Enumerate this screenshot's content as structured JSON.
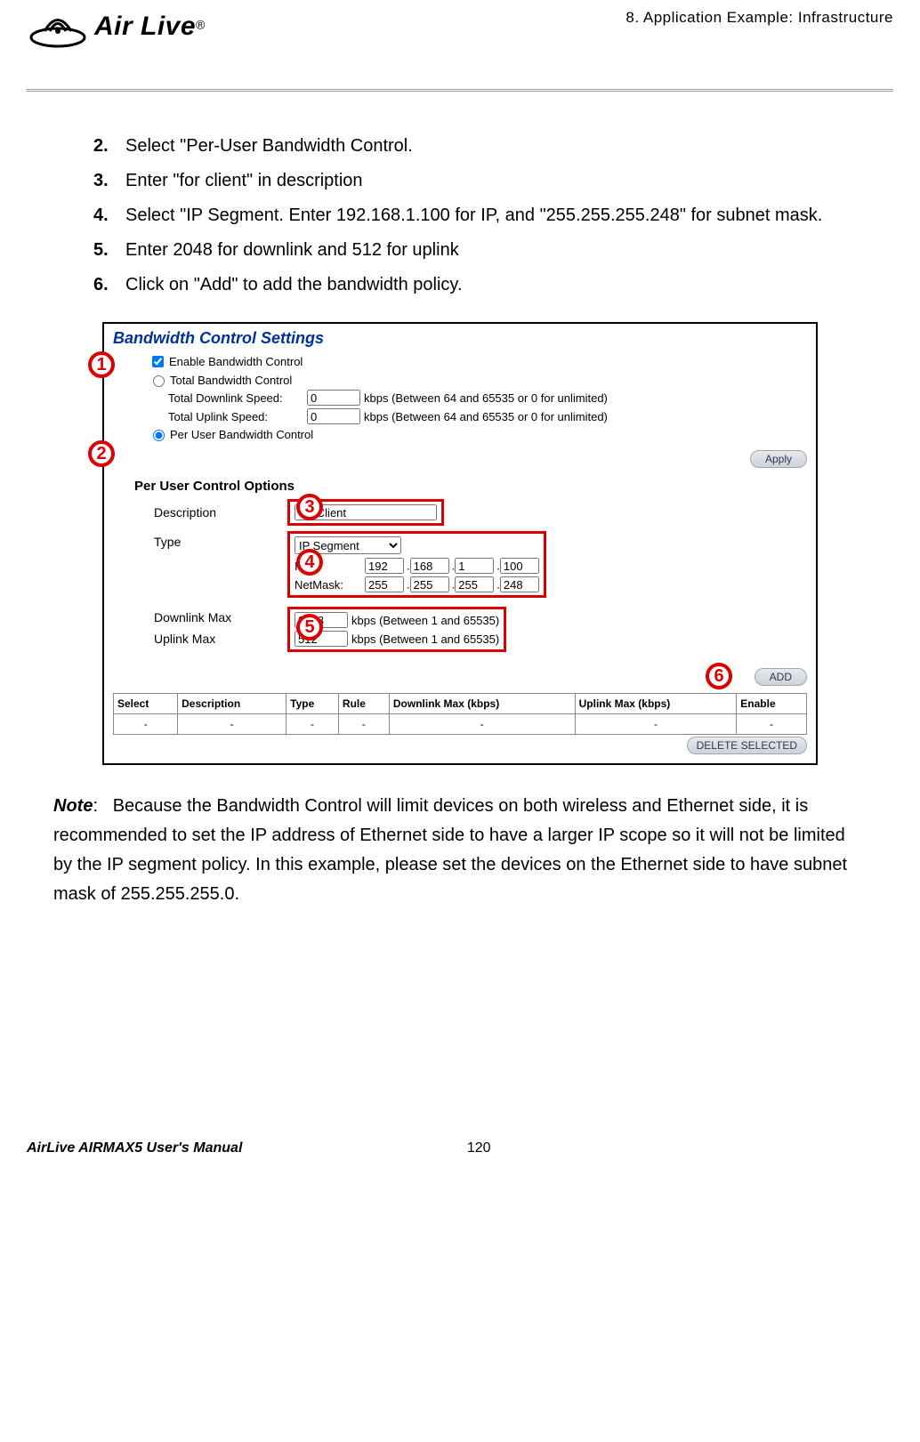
{
  "header": {
    "breadcrumb": "8. Application Example: Infrastructure",
    "logo_text": "Air Live",
    "trademark": "®"
  },
  "steps": [
    {
      "n": "2.",
      "t": "Select \"Per-User Bandwidth Control."
    },
    {
      "n": "3.",
      "t": "Enter \"for client\" in description"
    },
    {
      "n": "4.",
      "t": "Select \"IP Segment.   Enter 192.168.1.100 for IP, and \"255.255.255.248\" for subnet mask."
    },
    {
      "n": "5.",
      "t": "Enter 2048 for downlink and 512 for uplink"
    },
    {
      "n": "6.",
      "t": "Click on \"Add\" to add the bandwidth policy."
    }
  ],
  "panel": {
    "title": "Bandwidth Control Settings",
    "enable_label": "Enable Bandwidth Control",
    "total_bw_label": "Total Bandwidth Control",
    "downlink_speed_label": "Total Downlink Speed:",
    "uplink_speed_label": "Total Uplink Speed:",
    "downlink_speed_value": "0",
    "uplink_speed_value": "0",
    "kbps_hint": "kbps (Between 64 and 65535 or 0 for unlimited)",
    "per_user_label": "Per User Bandwidth Control",
    "apply_btn": "Apply",
    "options_heading": "Per User Control Options",
    "desc_label": "Description",
    "desc_value": "for Client",
    "type_label": "Type",
    "type_value": "IP Segment",
    "ip_label": "IP:",
    "netmask_label": "NetMask:",
    "ip": [
      "192",
      "168",
      "1",
      "100"
    ],
    "mask": [
      "255",
      "255",
      "255",
      "248"
    ],
    "downlink_max_label": "Downlink Max",
    "uplink_max_label": "Uplink Max",
    "downlink_max_value": "2048",
    "uplink_max_value": "512",
    "kbps_hint2": "kbps (Between 1 and 65535)",
    "add_btn": "ADD",
    "delete_btn": "DELETE SELECTED",
    "table": {
      "headers": [
        "Select",
        "Description",
        "Type",
        "Rule",
        "Downlink Max (kbps)",
        "Uplink Max (kbps)",
        "Enable"
      ],
      "empty_row": [
        "-",
        "-",
        "-",
        "-",
        "-",
        "-",
        "-"
      ]
    },
    "badges": [
      "1",
      "2",
      "3",
      "4",
      "5",
      "6"
    ]
  },
  "note": {
    "label": "Note",
    "colon": ":",
    "text": "Because the Bandwidth Control will limit devices on both wireless and Ethernet side, it is recommended to set the IP address of Ethernet side to have a larger IP scope so it will not be limited by the IP segment policy.   In this example, please set the devices on the Ethernet side to have subnet mask of 255.255.255.0."
  },
  "footer": {
    "manual": "AirLive AIRMAX5 User's Manual",
    "page": "120"
  }
}
